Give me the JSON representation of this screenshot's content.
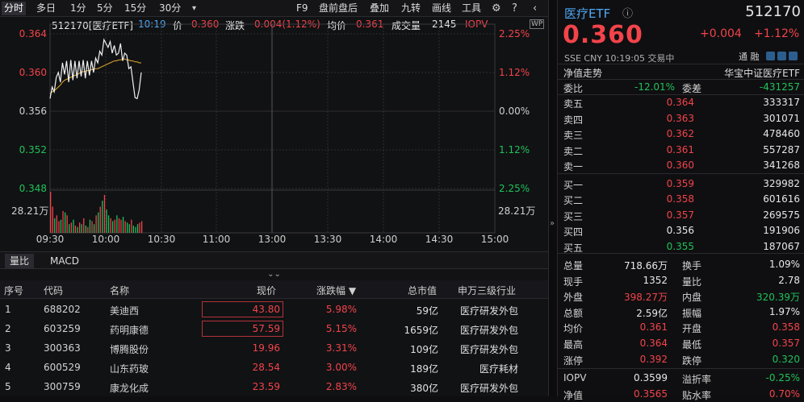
{
  "toolbar": {
    "items": [
      "分时",
      "多日",
      "1分",
      "5分",
      "15分",
      "30分"
    ],
    "right_items": [
      "F9",
      "盘前盘后",
      "叠加",
      "九转",
      "画线",
      "工具"
    ]
  },
  "chart_header": {
    "code_name": "512170[医疗ETF]",
    "time": "10:19",
    "price_label": "价",
    "price": "0.360",
    "change_label": "涨跌",
    "change": "0.004(1.12%)",
    "avg_label": "均价",
    "avg": "0.361",
    "vol_label": "成交量",
    "vol": "2145",
    "iopv_label": "IOPV"
  },
  "chart_data": {
    "type": "line",
    "y_ticks_left": [
      "0.364",
      "0.360",
      "0.356",
      "0.352",
      "0.348"
    ],
    "y_ticks_right": [
      "2.25%",
      "1.12%",
      "0.00%",
      "1.12%",
      "2.25%"
    ],
    "y_range": [
      0.348,
      0.364
    ],
    "x_ticks": [
      "09:30",
      "10:00",
      "10:30",
      "11:00",
      "13:00",
      "13:30",
      "14:00",
      "14:30",
      "15:00"
    ],
    "volume_label_left": "28.21万",
    "volume_label_right": "28.21万",
    "series": [
      {
        "values": [
          0.3573,
          0.3585,
          0.358,
          0.3595,
          0.36,
          0.359,
          0.361,
          0.3598,
          0.3612,
          0.359,
          0.3613,
          0.3592,
          0.3612,
          0.3594,
          0.3612,
          0.3596,
          0.3613,
          0.3594,
          0.3612,
          0.3597,
          0.3612,
          0.36,
          0.3615,
          0.361,
          0.3622,
          0.3618,
          0.3634,
          0.363,
          0.3626,
          0.3632,
          0.362,
          0.3628,
          0.3618,
          0.362,
          0.363,
          0.3612,
          0.362,
          0.3618,
          0.3604,
          0.3606,
          0.359,
          0.3574,
          0.3573,
          0.3582,
          0.36
        ]
      },
      {
        "values": [
          0.3578,
          0.358,
          0.3581,
          0.3583,
          0.3585,
          0.3587,
          0.359,
          0.3592,
          0.3593,
          0.3594,
          0.3595,
          0.3596,
          0.3597,
          0.3598,
          0.3599,
          0.36,
          0.3601,
          0.3601,
          0.3602,
          0.3602,
          0.3603,
          0.3603,
          0.3604,
          0.3604,
          0.3605,
          0.3606,
          0.3607,
          0.3608,
          0.3609,
          0.361,
          0.3611,
          0.3612,
          0.3612,
          0.3613,
          0.3613,
          0.3614,
          0.3614,
          0.3613,
          0.3613,
          0.3612,
          0.3612,
          0.3611,
          0.3611,
          0.361,
          0.361
        ]
      }
    ],
    "volume": [
      28.21,
      18,
      10,
      12,
      8,
      9,
      15,
      14,
      12,
      6,
      7,
      9,
      5,
      4,
      7,
      6,
      10,
      5,
      4,
      9,
      8,
      6,
      12,
      14,
      18,
      22,
      26,
      16,
      12,
      10,
      8,
      9,
      12,
      10,
      9,
      11,
      8,
      7,
      6,
      9,
      5,
      4,
      6,
      7,
      8
    ]
  },
  "lower_tabs": [
    "量比",
    "MACD"
  ],
  "table": {
    "headers": [
      "序号",
      "代码",
      "名称",
      "现价",
      "涨跌幅 ▼",
      "总市值",
      "申万三级行业"
    ],
    "rows": [
      {
        "n": "1",
        "code": "688202",
        "name": "美迪西",
        "price": "43.80",
        "pct": "5.98%",
        "cap": "59亿",
        "ind": "医疗研发外包"
      },
      {
        "n": "2",
        "code": "603259",
        "name": "药明康德",
        "price": "57.59",
        "pct": "5.15%",
        "cap": "1659亿",
        "ind": "医疗研发外包"
      },
      {
        "n": "3",
        "code": "300363",
        "name": "博腾股份",
        "price": "19.96",
        "pct": "3.31%",
        "cap": "109亿",
        "ind": "医疗研发外包"
      },
      {
        "n": "4",
        "code": "600529",
        "name": "山东药玻",
        "price": "28.54",
        "pct": "3.00%",
        "cap": "189亿",
        "ind": "医疗耗材"
      },
      {
        "n": "5",
        "code": "300759",
        "name": "康龙化成",
        "price": "23.59",
        "pct": "2.83%",
        "cap": "380亿",
        "ind": "医疗研发外包"
      }
    ]
  },
  "quote": {
    "title": "医疗ETF",
    "code": "512170",
    "price": "0.360",
    "change": "+0.004",
    "change_pct": "+1.12%",
    "meta": "SSE  CNY  10:19:05  交易中",
    "meta_right": "通 融",
    "nav_trend": "净值走势",
    "fund_name": "华宝中证医疗ETF",
    "weibi_label": "委比",
    "weibi": "-12.01%",
    "weicha_label": "委差",
    "weicha": "-431257",
    "sell": [
      {
        "label": "卖五",
        "price": "0.364",
        "vol": "333317"
      },
      {
        "label": "卖四",
        "price": "0.363",
        "vol": "301071"
      },
      {
        "label": "卖三",
        "price": "0.362",
        "vol": "478460"
      },
      {
        "label": "卖二",
        "price": "0.361",
        "vol": "557287"
      },
      {
        "label": "卖一",
        "price": "0.360",
        "vol": "341268"
      }
    ],
    "buy": [
      {
        "label": "买一",
        "price": "0.359",
        "vol": "329982"
      },
      {
        "label": "买二",
        "price": "0.358",
        "vol": "601616"
      },
      {
        "label": "买三",
        "price": "0.357",
        "vol": "269575"
      },
      {
        "label": "买四",
        "price": "0.356",
        "vol": "191906"
      },
      {
        "label": "买五",
        "price": "0.355",
        "vol": "187067"
      }
    ],
    "stats": [
      {
        "l1": "总量",
        "v1": "718.66万",
        "l2": "换手",
        "v2": "1.09%",
        "c1": "white",
        "c2": "white"
      },
      {
        "l1": "现手",
        "v1": "1352",
        "l2": "量比",
        "v2": "2.78",
        "c1": "white",
        "c2": "white"
      },
      {
        "l1": "外盘",
        "v1": "398.27万",
        "l2": "内盘",
        "v2": "320.39万",
        "c1": "red",
        "c2": "green"
      },
      {
        "l1": "总额",
        "v1": "2.59亿",
        "l2": "振幅",
        "v2": "1.97%",
        "c1": "white",
        "c2": "white"
      },
      {
        "l1": "均价",
        "v1": "0.361",
        "l2": "开盘",
        "v2": "0.358",
        "c1": "red",
        "c2": "red"
      },
      {
        "l1": "最高",
        "v1": "0.364",
        "l2": "最低",
        "v2": "0.357",
        "c1": "red",
        "c2": "red"
      },
      {
        "l1": "涨停",
        "v1": "0.392",
        "l2": "跌停",
        "v2": "0.320",
        "c1": "red",
        "c2": "green"
      },
      {
        "l1": "IOPV",
        "v1": "0.3599",
        "l2": "溢折率",
        "v2": "-0.25%",
        "c1": "white",
        "c2": "green"
      },
      {
        "l1": "净值",
        "v1": "0.3565",
        "l2": "贴水率",
        "v2": "0.70%",
        "c1": "red",
        "c2": "red"
      }
    ]
  }
}
